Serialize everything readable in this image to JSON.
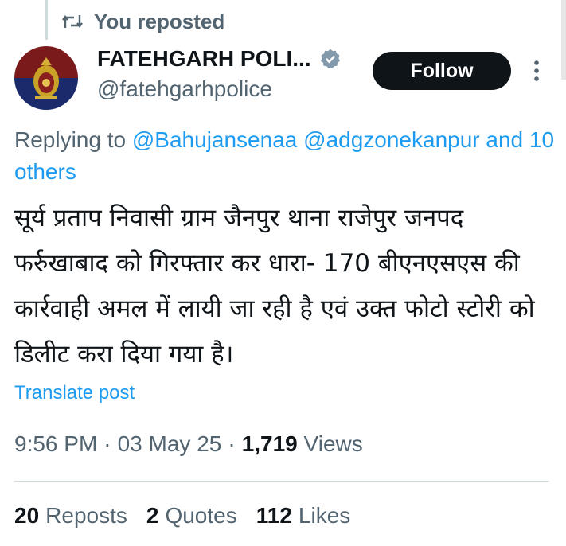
{
  "repost_header": {
    "label": "You reposted",
    "icon": "repost-icon"
  },
  "author": {
    "display_name": "FATEHGARH POLI...",
    "handle": "@fatehgarhpolice",
    "verified_icon": "verified-badge-icon",
    "verified_color": "#829aab"
  },
  "follow_button": {
    "label": "Follow"
  },
  "reply": {
    "prefix": "Replying to",
    "mentions": [
      "@Bahujansenaa",
      "@adgzonekanpur"
    ],
    "conjunction": "and",
    "others": "10 others"
  },
  "tweet": {
    "text": "सूर्य प्रताप निवासी ग्राम जैनपुर थाना राजेपुर जनपद फर्रुखाबाद को गिरफ्तार कर धारा- 170 बीएनएसएस की कार्रवाही अमल में लायी जा रही है एवं उक्त फोटो स्टोरी को डिलीट करा दिया गया है।"
  },
  "translate_link": "Translate post",
  "meta": {
    "time": "9:56 PM",
    "date": "03 May 25",
    "views_count": "1,719",
    "views_label": "Views"
  },
  "stats": [
    {
      "count": "20",
      "label": "Reposts"
    },
    {
      "count": "2",
      "label": "Quotes"
    },
    {
      "count": "112",
      "label": "Likes"
    }
  ],
  "colors": {
    "accent": "#1d9bf0",
    "text": "#0f1419",
    "secondary": "#536471"
  }
}
